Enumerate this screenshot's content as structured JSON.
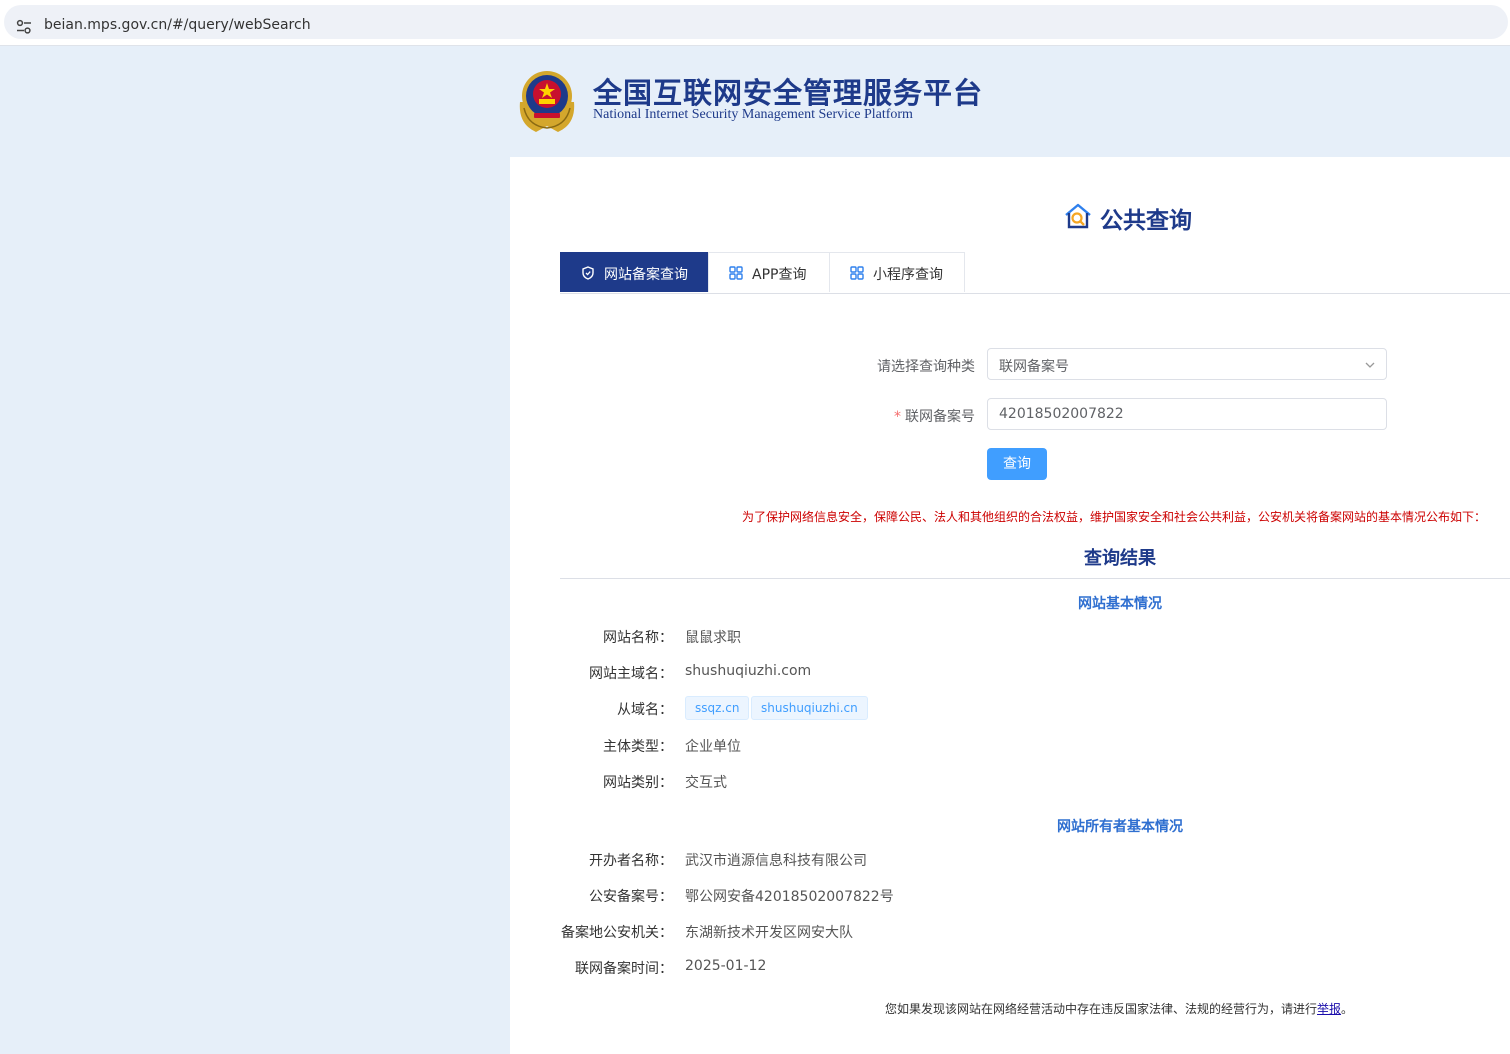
{
  "browser": {
    "url": "beian.mps.gov.cn/#/query/webSearch"
  },
  "header": {
    "title": "全国互联网安全管理服务平台",
    "subtitle": "National Internet Security Management Service Platform"
  },
  "page": {
    "title": "公共查询"
  },
  "tabs": [
    {
      "label": "网站备案查询",
      "icon": "shield-icon",
      "active": true
    },
    {
      "label": "APP查询",
      "icon": "grid-icon",
      "active": false
    },
    {
      "label": "小程序查询",
      "icon": "grid-icon",
      "active": false
    }
  ],
  "form": {
    "type_label": "请选择查询种类",
    "type_value": "联网备案号",
    "number_label": "联网备案号",
    "number_value": "42018502007822",
    "submit_label": "查询"
  },
  "notice": "为了保护网络信息安全，保障公民、法人和其他组织的合法权益，维护国家安全和社会公共利益，公安机关将备案网站的基本情况公布如下：",
  "results": {
    "title": "查询结果",
    "basic_title": "网站基本情况",
    "basic_rows": [
      {
        "label": "网站名称：",
        "value": "鼠鼠求职"
      },
      {
        "label": "网站主域名：",
        "value": "shushuqiuzhi.com"
      },
      {
        "label": "从域名：",
        "value": ""
      },
      {
        "label": "主体类型：",
        "value": "企业单位"
      },
      {
        "label": "网站类别：",
        "value": "交互式"
      }
    ],
    "sub_domains": [
      "ssqz.cn",
      "shushuqiuzhi.cn"
    ],
    "owner_title": "网站所有者基本情况",
    "owner_rows": [
      {
        "label": "开办者名称：",
        "value": "武汉市逍源信息科技有限公司"
      },
      {
        "label": "公安备案号：",
        "value": "鄂公网安备42018502007822号"
      },
      {
        "label": "备案地公安机关：",
        "value": "东湖新技术开发区网安大队"
      },
      {
        "label": "联网备案时间：",
        "value": "2025-01-12"
      }
    ]
  },
  "footer": {
    "text": "您如果发现该网站在网络经营活动中存在违反国家法律、法规的经营行为，请进行",
    "link": "举报",
    "end": "。"
  },
  "colors": {
    "brand": "#1e3a8a",
    "accent": "#409eff",
    "notice": "#cc0000",
    "section": "#2f6fd0"
  }
}
